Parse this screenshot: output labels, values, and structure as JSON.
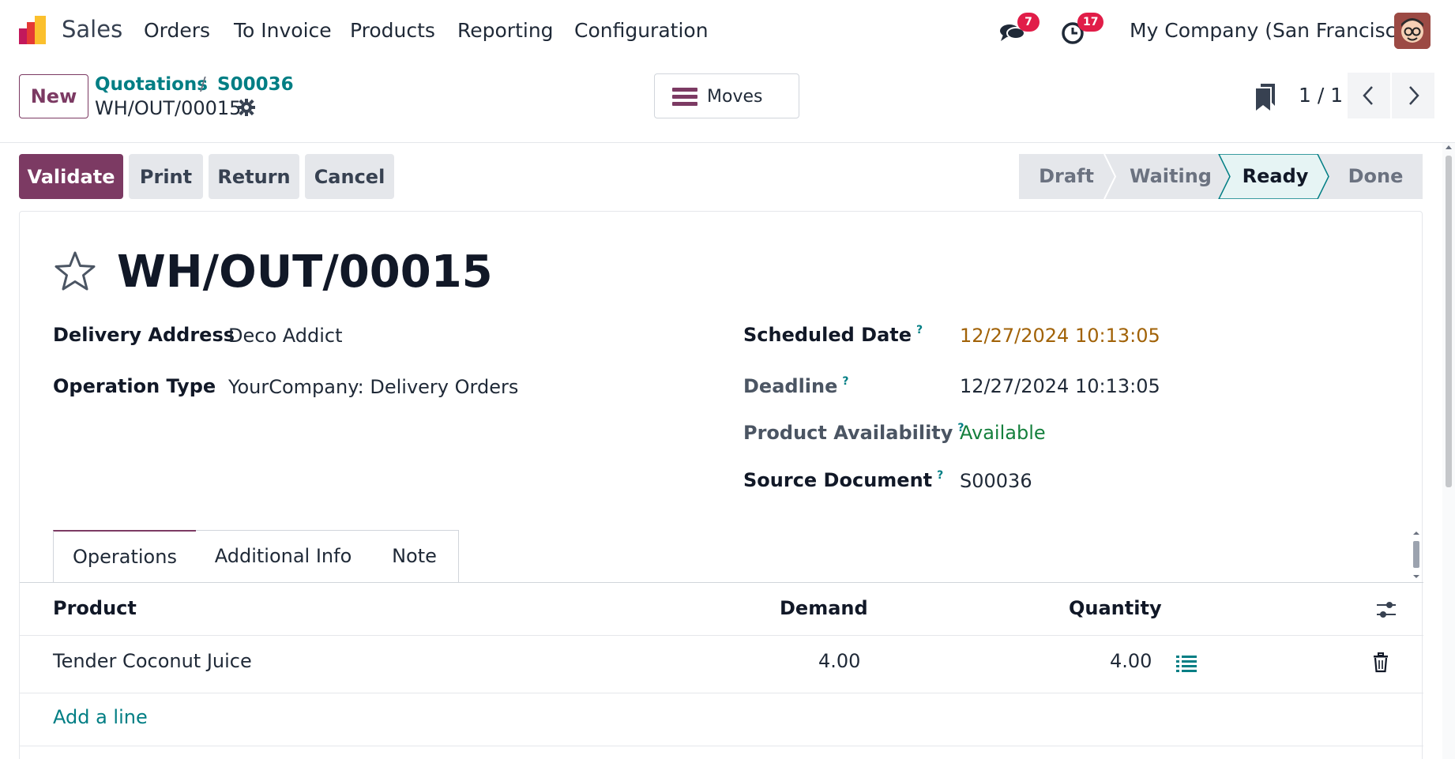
{
  "app": {
    "name": "Sales"
  },
  "nav": {
    "menu": [
      "Orders",
      "To Invoice",
      "Products",
      "Reporting",
      "Configuration"
    ],
    "messages_count": "7",
    "activities_count": "17",
    "company": "My Company (San Francisco)"
  },
  "control": {
    "new_label": "New",
    "breadcrumb": [
      "Quotations",
      "S00036"
    ],
    "breadcrumb_sep": "/",
    "current": "WH/OUT/00015",
    "moves_label": "Moves",
    "pager": "1 / 1"
  },
  "actions": {
    "validate": "Validate",
    "print": "Print",
    "return": "Return",
    "cancel": "Cancel"
  },
  "status": {
    "stages": [
      "Draft",
      "Waiting",
      "Ready",
      "Done"
    ],
    "current": "Ready"
  },
  "record": {
    "title": "WH/OUT/00015",
    "delivery_address_label": "Delivery Address",
    "delivery_address": "Deco Addict",
    "operation_type_label": "Operation Type",
    "operation_type": "YourCompany: Delivery Orders",
    "scheduled_date_label": "Scheduled Date",
    "scheduled_date": "12/27/2024 10:13:05",
    "deadline_label": "Deadline",
    "deadline": "12/27/2024 10:13:05",
    "availability_label": "Product Availability",
    "availability": "Available",
    "source_label": "Source Document",
    "source": "S00036",
    "help_mark": "?"
  },
  "tabs": [
    "Operations",
    "Additional Info",
    "Note"
  ],
  "table": {
    "headers": {
      "product": "Product",
      "demand": "Demand",
      "quantity": "Quantity"
    },
    "rows": [
      {
        "product": "Tender Coconut Juice",
        "demand": "4.00",
        "quantity": "4.00"
      }
    ],
    "add_line": "Add a line"
  },
  "colors": {
    "brand": "#7c3a63",
    "link": "#017e84",
    "scheduled_date": "#a16207",
    "available": "#15803d",
    "badge": "#e11d48"
  }
}
